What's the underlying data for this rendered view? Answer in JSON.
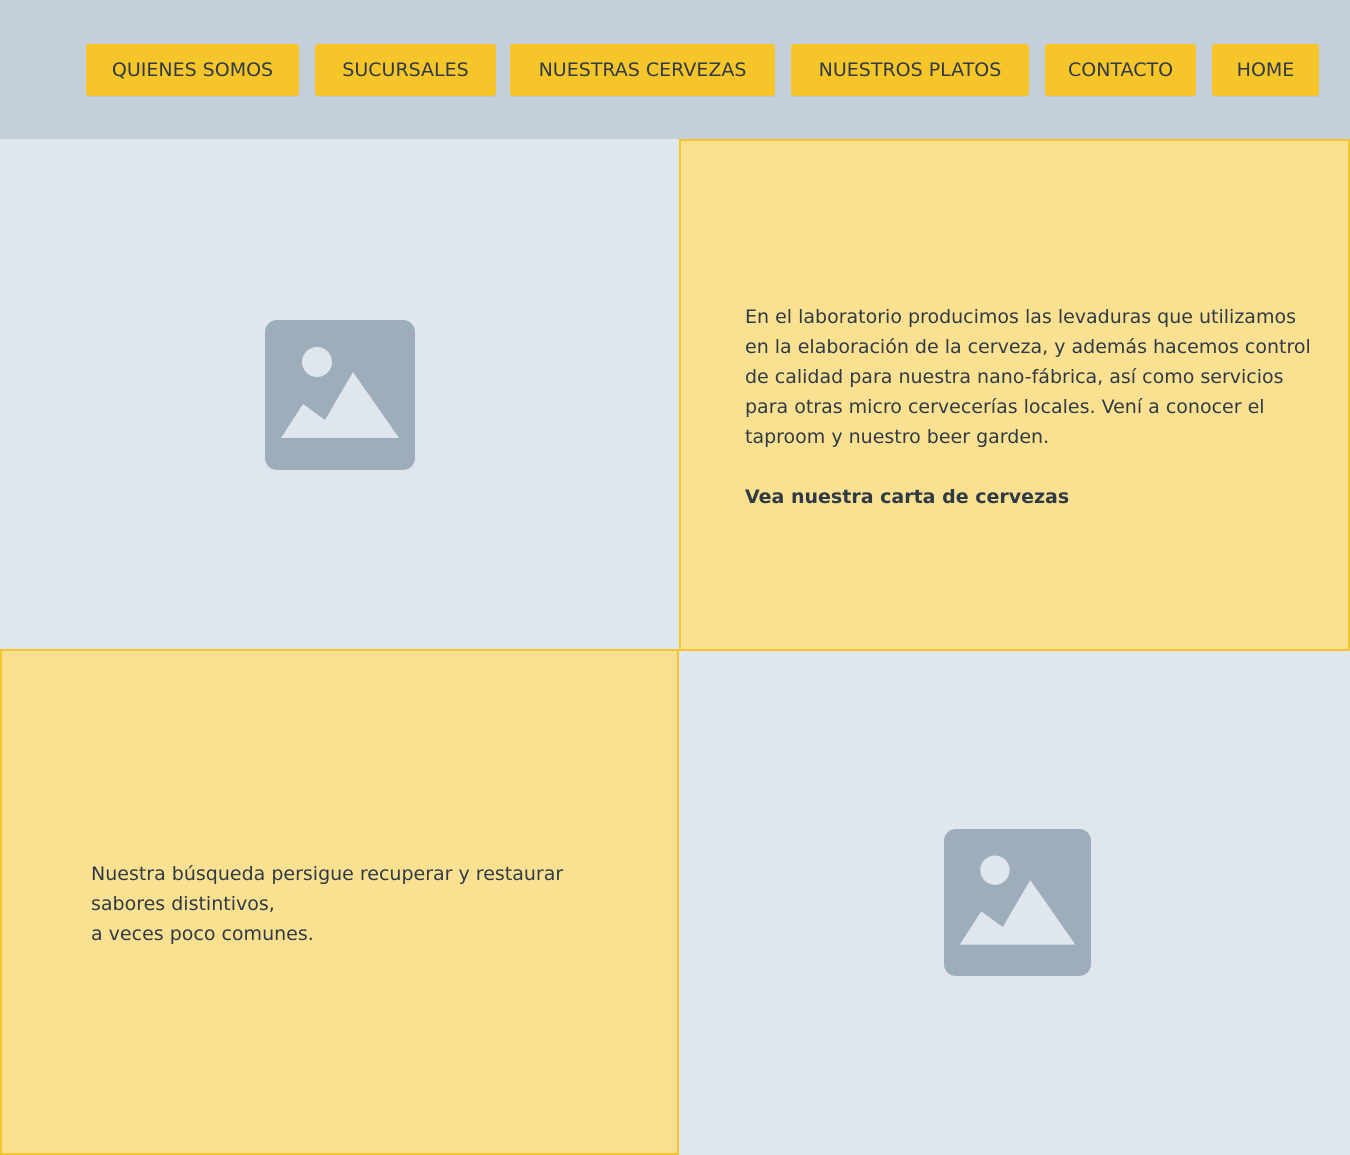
{
  "colors": {
    "header_bg": "#c4cfd9",
    "button_bg": "#f6c52a",
    "panel_text_bg": "#fae192",
    "panel_image_bg": "#e0e6ee",
    "placeholder_icon": "#9eadba",
    "text": "#2f3a44"
  },
  "nav": {
    "items": [
      {
        "label": "QUIENES SOMOS"
      },
      {
        "label": "SUCURSALES"
      },
      {
        "label": "NUESTRAS CERVEZAS"
      },
      {
        "label": "NUESTROS PLATOS"
      },
      {
        "label": "CONTACTO"
      },
      {
        "label": "HOME"
      }
    ]
  },
  "section1": {
    "image_icon": "image-placeholder-icon",
    "body": "En el laboratorio producimos las levaduras que utilizamos\nen la elaboración de la cerveza, y además hacemos control\nde calidad para nuestra nano-fábrica, así como servicios\npara otras micro cervecerías locales. Vení a conocer el\ntaproom y nuestro beer garden.",
    "link": "Vea nuestra carta de cervezas"
  },
  "section2": {
    "body": "Nuestra búsqueda persigue recuperar y restaurar\nsabores distintivos,\na veces poco comunes.",
    "image_icon": "image-placeholder-icon"
  }
}
